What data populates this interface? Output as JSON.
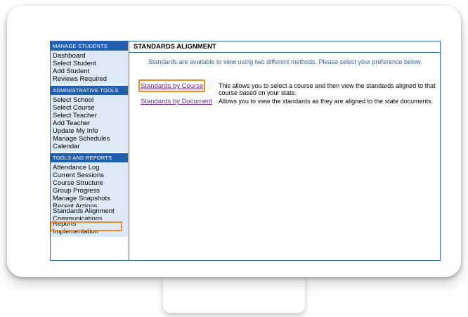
{
  "sidebar": {
    "sections": [
      {
        "header": "MANAGE STUDENTS",
        "items": [
          "Dashboard",
          "Select Student",
          "Add Student",
          "Reviews Required"
        ]
      },
      {
        "header": "ADMINISTRATIVE TOOLS",
        "items": [
          "Select School",
          "Select Course",
          "Select Teacher",
          "Add Teacher",
          "Update My Info",
          "Manage Schedules",
          "Calendar"
        ]
      },
      {
        "header": "TOOLS AND REPORTS",
        "items": [
          "Attendance Log",
          "Current Sessions",
          "Course Structure",
          "Group Progress",
          "Manage Snapshots",
          "Recent Actions",
          "Standards Alignment",
          "Communications",
          "Reports",
          "Implementation"
        ]
      }
    ]
  },
  "main": {
    "title": "STANDARDS ALIGNMENT",
    "intro": "Standards are available to view using two different methods. Please select your preference below.",
    "options": [
      {
        "link": "Standards by Course",
        "description": "This allows you to select a course and then view the standards aligned to that course based on your state."
      },
      {
        "link": "Standards by Document",
        "description": "Allows you to view the standards as they are aligned to the state documents."
      }
    ]
  },
  "colors": {
    "header_blue": "#1f5fae",
    "sidebar_bg": "#ddeaf6",
    "highlight_orange": "#f08a2a",
    "link_purple": "#6a2a8a"
  }
}
